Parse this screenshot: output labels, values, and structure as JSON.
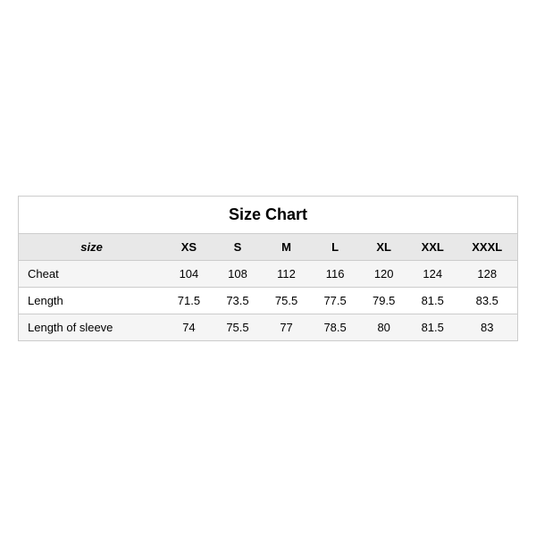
{
  "table": {
    "title": "Size Chart",
    "headers": {
      "size_label": "size",
      "columns": [
        "XS",
        "S",
        "M",
        "L",
        "XL",
        "XXL",
        "XXXL"
      ]
    },
    "rows": [
      {
        "label": "Cheat",
        "values": [
          "104",
          "108",
          "112",
          "116",
          "120",
          "124",
          "128"
        ]
      },
      {
        "label": "Length",
        "values": [
          "71.5",
          "73.5",
          "75.5",
          "77.5",
          "79.5",
          "81.5",
          "83.5"
        ]
      },
      {
        "label": "Length of sleeve",
        "values": [
          "74",
          "75.5",
          "77",
          "78.5",
          "80",
          "81.5",
          "83"
        ]
      }
    ]
  }
}
